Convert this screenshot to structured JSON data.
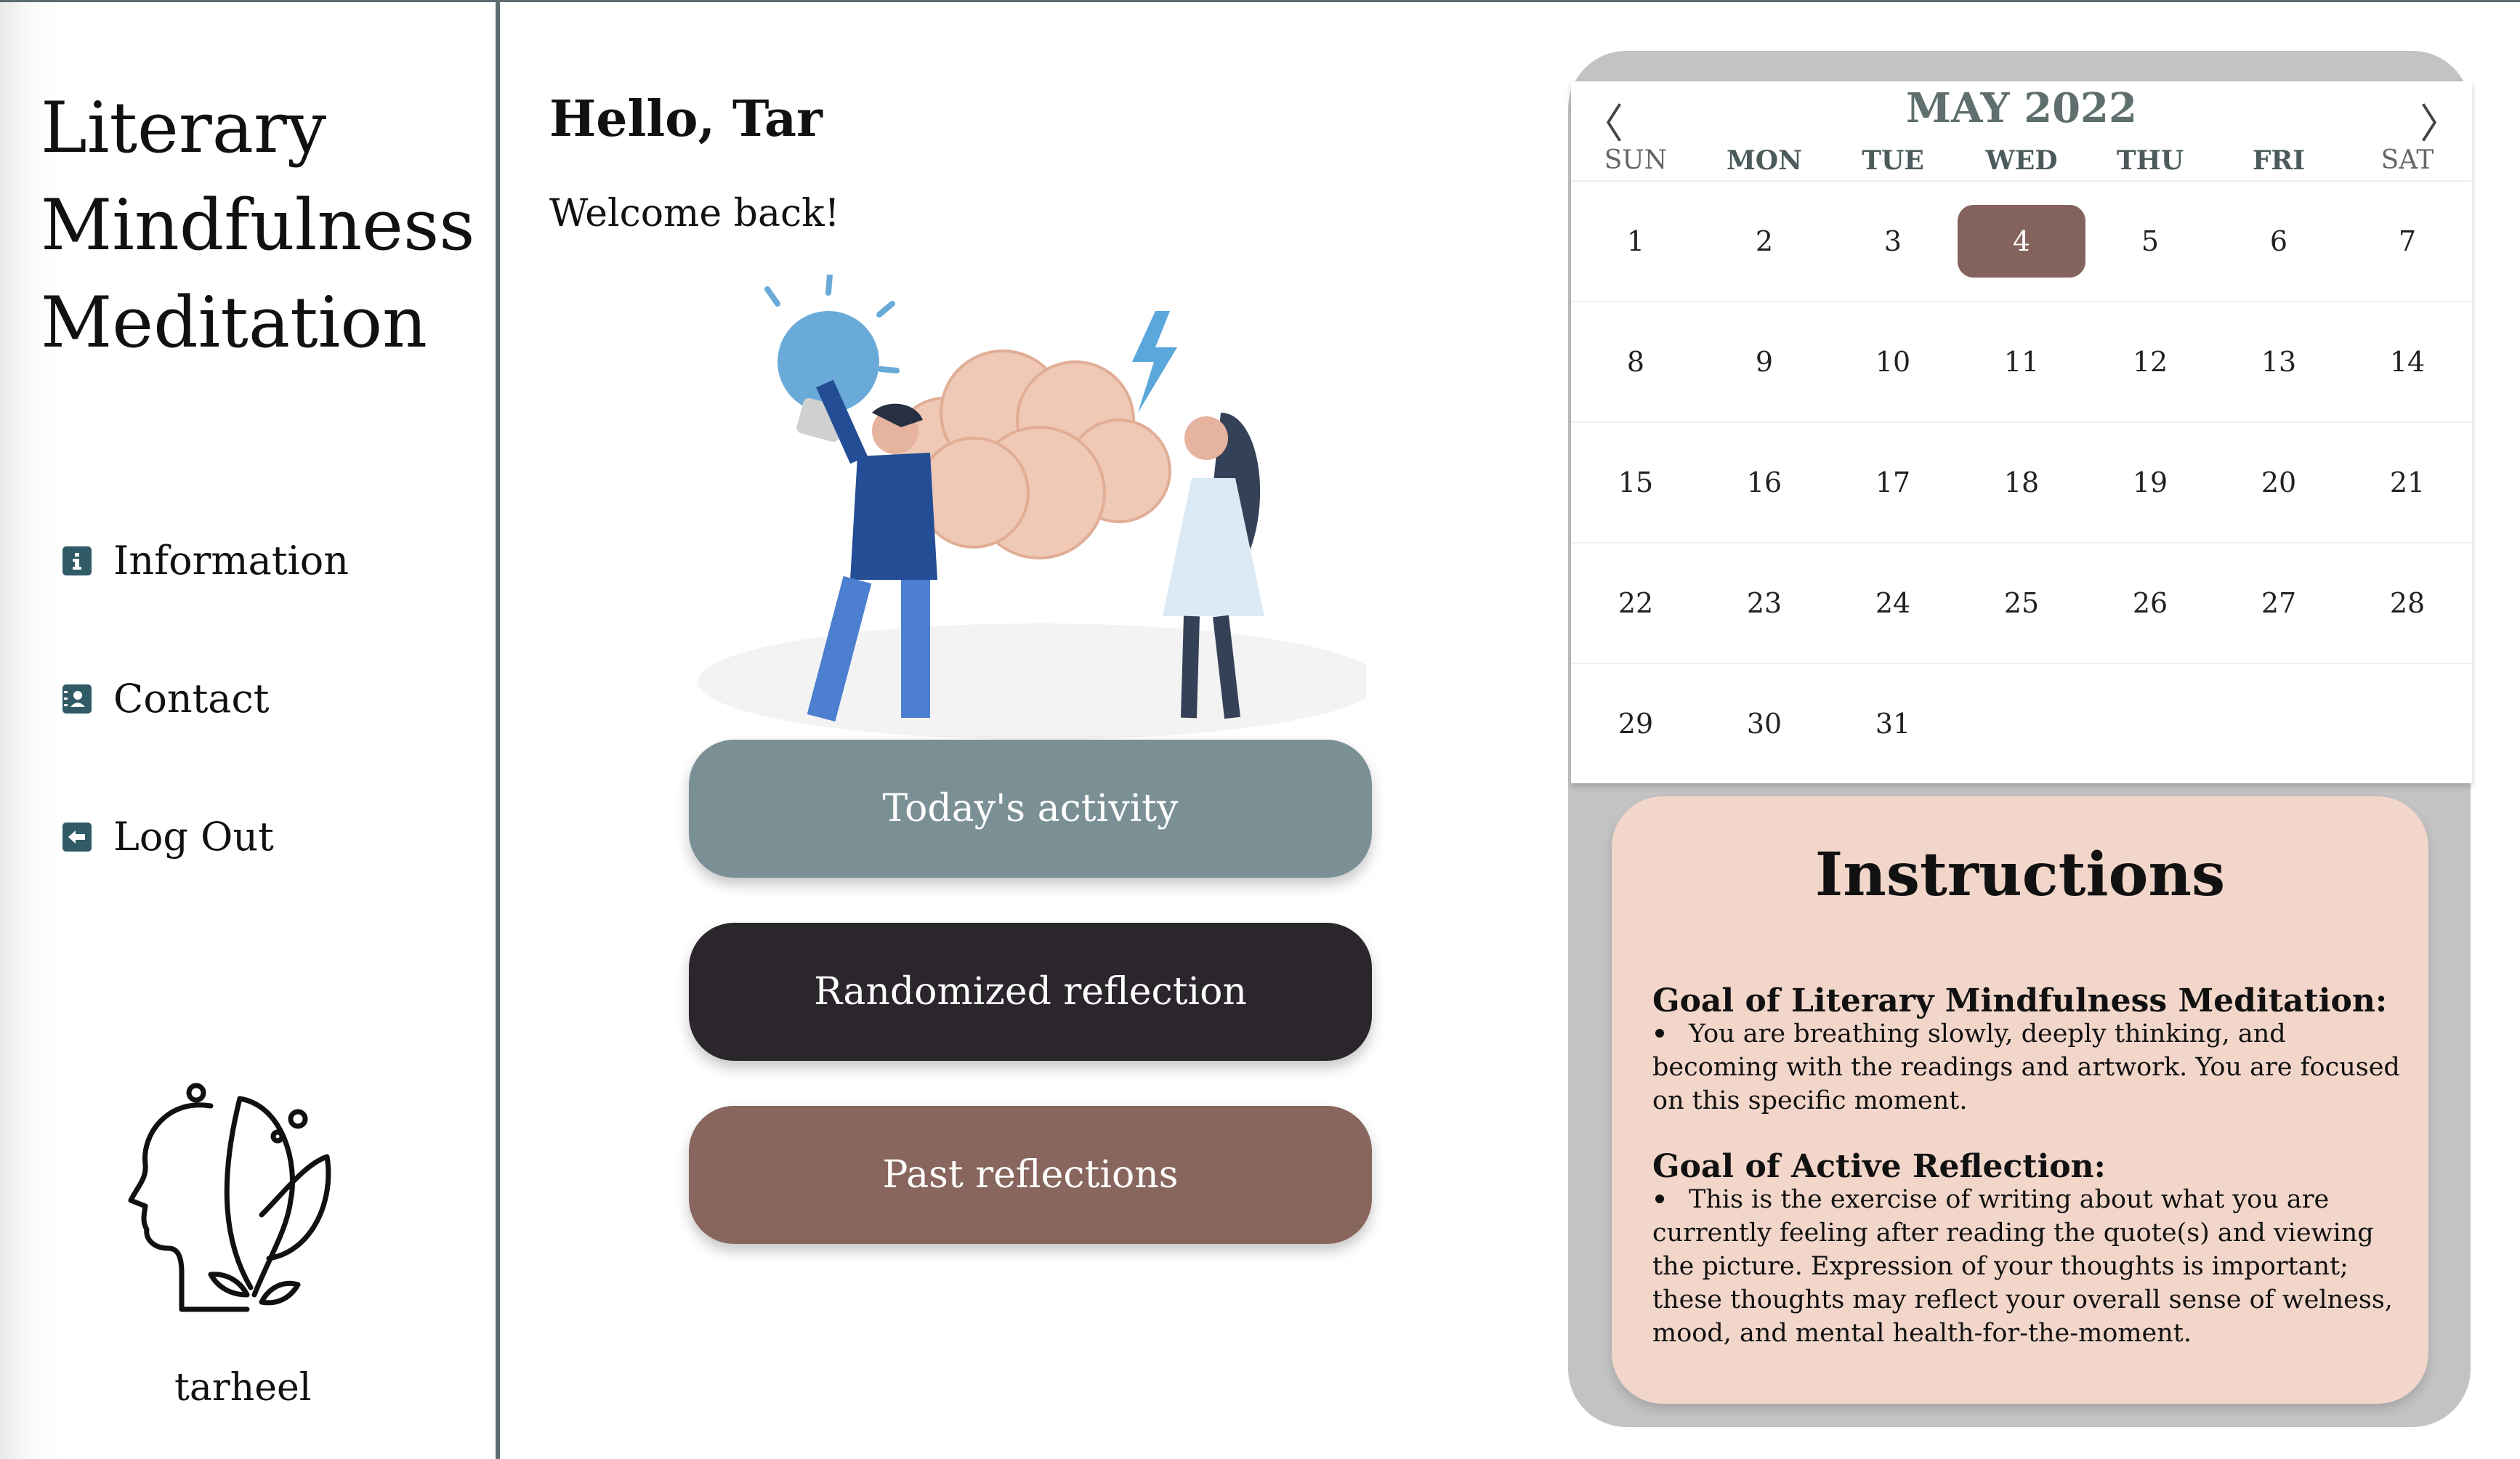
{
  "sidebar": {
    "title_lines": [
      "Literary",
      "Mindfulness",
      "Meditation"
    ],
    "nav": [
      {
        "label": "Information",
        "icon": "info-icon"
      },
      {
        "label": "Contact",
        "icon": "contact-card-icon"
      },
      {
        "label": "Log Out",
        "icon": "logout-icon"
      }
    ],
    "logo_icon": "head-leaf-icon",
    "username": "tarheel"
  },
  "main": {
    "greeting": "Hello, Tar",
    "welcome": "Welcome back!",
    "illustration_icon": "brainstorm-illustration",
    "buttons": [
      {
        "label": "Today's activity",
        "color": "#7b9095"
      },
      {
        "label": "Randomized reflection",
        "color": "#2b252c"
      },
      {
        "label": "Past reflections",
        "color": "#88665e"
      }
    ]
  },
  "calendar": {
    "title": "MAY 2022",
    "prev_icon": "chevron-left-icon",
    "next_icon": "chevron-right-icon",
    "weekdays": [
      "SUN",
      "MON",
      "TUE",
      "WED",
      "THU",
      "FRI",
      "SAT"
    ],
    "days": [
      "1",
      "2",
      "3",
      "4",
      "5",
      "6",
      "7",
      "8",
      "9",
      "10",
      "11",
      "12",
      "13",
      "14",
      "15",
      "16",
      "17",
      "18",
      "19",
      "20",
      "21",
      "22",
      "23",
      "24",
      "25",
      "26",
      "27",
      "28",
      "29",
      "30",
      "31"
    ],
    "selected_day": "4",
    "accent_color": "#84635c"
  },
  "instructions": {
    "title": "Instructions",
    "sections": [
      {
        "heading": "Goal of Literary Mindfulness Meditation:",
        "text": "You are breathing slowly, deeply thinking, and becoming with the readings and artwork. You are focused on this specific moment."
      },
      {
        "heading": "Goal of Active Reflection:",
        "text": "This is the exercise of writing about what you are currently feeling after reading the quote(s) and viewing the picture. Expression of your thoughts is important; these thoughts may reflect your overall sense of welness, mood, and mental health-for-the-moment."
      }
    ]
  }
}
